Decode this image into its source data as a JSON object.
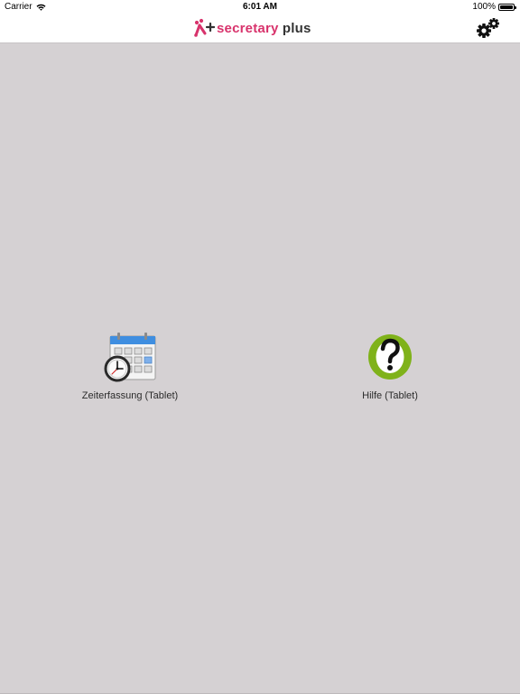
{
  "status_bar": {
    "carrier": "Carrier",
    "time": "6:01 AM",
    "battery": "100%",
    "battery_level": 1.0
  },
  "header": {
    "logo": {
      "brand_word": "secretary",
      "plus_word": "plus",
      "brand_color": "#d8336c"
    },
    "settings_icon": "gears-icon"
  },
  "tiles": [
    {
      "label": "Zeiterfassung (Tablet)",
      "icon": "calendar-clock-icon"
    },
    {
      "label": "Hilfe (Tablet)",
      "icon": "help-question-icon"
    }
  ],
  "colors": {
    "background": "#d5d1d3",
    "bar": "#ffffff",
    "brand": "#d8336c",
    "help_green": "#7fb21a",
    "calendar_blue": "#3f8ee0"
  }
}
